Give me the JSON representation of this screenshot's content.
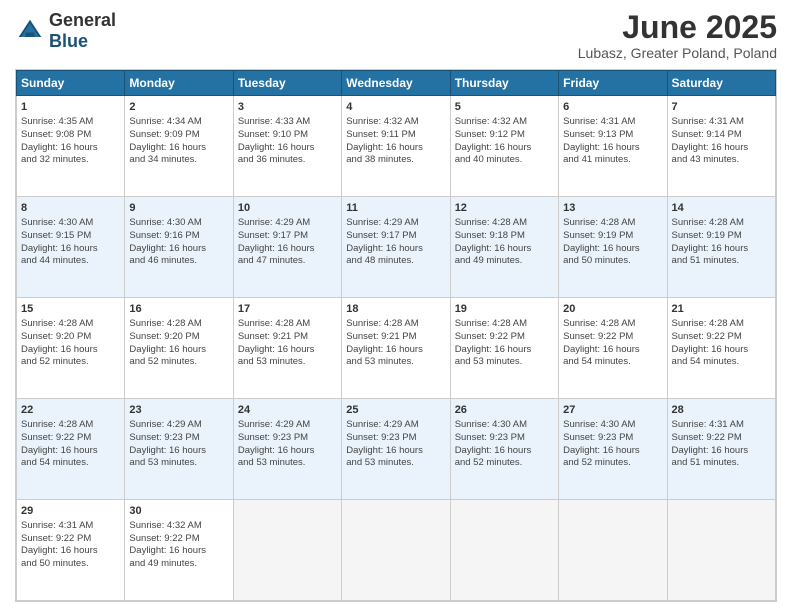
{
  "header": {
    "logo_general": "General",
    "logo_blue": "Blue",
    "month_title": "June 2025",
    "subtitle": "Lubasz, Greater Poland, Poland"
  },
  "calendar": {
    "days_of_week": [
      "Sunday",
      "Monday",
      "Tuesday",
      "Wednesday",
      "Thursday",
      "Friday",
      "Saturday"
    ],
    "weeks": [
      [
        {
          "day": "",
          "info": ""
        },
        {
          "day": "2",
          "info": "Sunrise: 4:34 AM\nSunset: 9:09 PM\nDaylight: 16 hours\nand 34 minutes."
        },
        {
          "day": "3",
          "info": "Sunrise: 4:33 AM\nSunset: 9:10 PM\nDaylight: 16 hours\nand 36 minutes."
        },
        {
          "day": "4",
          "info": "Sunrise: 4:32 AM\nSunset: 9:11 PM\nDaylight: 16 hours\nand 38 minutes."
        },
        {
          "day": "5",
          "info": "Sunrise: 4:32 AM\nSunset: 9:12 PM\nDaylight: 16 hours\nand 40 minutes."
        },
        {
          "day": "6",
          "info": "Sunrise: 4:31 AM\nSunset: 9:13 PM\nDaylight: 16 hours\nand 41 minutes."
        },
        {
          "day": "7",
          "info": "Sunrise: 4:31 AM\nSunset: 9:14 PM\nDaylight: 16 hours\nand 43 minutes."
        }
      ],
      [
        {
          "day": "8",
          "info": "Sunrise: 4:30 AM\nSunset: 9:15 PM\nDaylight: 16 hours\nand 44 minutes."
        },
        {
          "day": "9",
          "info": "Sunrise: 4:30 AM\nSunset: 9:16 PM\nDaylight: 16 hours\nand 46 minutes."
        },
        {
          "day": "10",
          "info": "Sunrise: 4:29 AM\nSunset: 9:17 PM\nDaylight: 16 hours\nand 47 minutes."
        },
        {
          "day": "11",
          "info": "Sunrise: 4:29 AM\nSunset: 9:17 PM\nDaylight: 16 hours\nand 48 minutes."
        },
        {
          "day": "12",
          "info": "Sunrise: 4:28 AM\nSunset: 9:18 PM\nDaylight: 16 hours\nand 49 minutes."
        },
        {
          "day": "13",
          "info": "Sunrise: 4:28 AM\nSunset: 9:19 PM\nDaylight: 16 hours\nand 50 minutes."
        },
        {
          "day": "14",
          "info": "Sunrise: 4:28 AM\nSunset: 9:19 PM\nDaylight: 16 hours\nand 51 minutes."
        }
      ],
      [
        {
          "day": "15",
          "info": "Sunrise: 4:28 AM\nSunset: 9:20 PM\nDaylight: 16 hours\nand 52 minutes."
        },
        {
          "day": "16",
          "info": "Sunrise: 4:28 AM\nSunset: 9:20 PM\nDaylight: 16 hours\nand 52 minutes."
        },
        {
          "day": "17",
          "info": "Sunrise: 4:28 AM\nSunset: 9:21 PM\nDaylight: 16 hours\nand 53 minutes."
        },
        {
          "day": "18",
          "info": "Sunrise: 4:28 AM\nSunset: 9:21 PM\nDaylight: 16 hours\nand 53 minutes."
        },
        {
          "day": "19",
          "info": "Sunrise: 4:28 AM\nSunset: 9:22 PM\nDaylight: 16 hours\nand 53 minutes."
        },
        {
          "day": "20",
          "info": "Sunrise: 4:28 AM\nSunset: 9:22 PM\nDaylight: 16 hours\nand 54 minutes."
        },
        {
          "day": "21",
          "info": "Sunrise: 4:28 AM\nSunset: 9:22 PM\nDaylight: 16 hours\nand 54 minutes."
        }
      ],
      [
        {
          "day": "22",
          "info": "Sunrise: 4:28 AM\nSunset: 9:22 PM\nDaylight: 16 hours\nand 54 minutes."
        },
        {
          "day": "23",
          "info": "Sunrise: 4:29 AM\nSunset: 9:23 PM\nDaylight: 16 hours\nand 53 minutes."
        },
        {
          "day": "24",
          "info": "Sunrise: 4:29 AM\nSunset: 9:23 PM\nDaylight: 16 hours\nand 53 minutes."
        },
        {
          "day": "25",
          "info": "Sunrise: 4:29 AM\nSunset: 9:23 PM\nDaylight: 16 hours\nand 53 minutes."
        },
        {
          "day": "26",
          "info": "Sunrise: 4:30 AM\nSunset: 9:23 PM\nDaylight: 16 hours\nand 52 minutes."
        },
        {
          "day": "27",
          "info": "Sunrise: 4:30 AM\nSunset: 9:23 PM\nDaylight: 16 hours\nand 52 minutes."
        },
        {
          "day": "28",
          "info": "Sunrise: 4:31 AM\nSunset: 9:22 PM\nDaylight: 16 hours\nand 51 minutes."
        }
      ],
      [
        {
          "day": "29",
          "info": "Sunrise: 4:31 AM\nSunset: 9:22 PM\nDaylight: 16 hours\nand 50 minutes."
        },
        {
          "day": "30",
          "info": "Sunrise: 4:32 AM\nSunset: 9:22 PM\nDaylight: 16 hours\nand 49 minutes."
        },
        {
          "day": "",
          "info": ""
        },
        {
          "day": "",
          "info": ""
        },
        {
          "day": "",
          "info": ""
        },
        {
          "day": "",
          "info": ""
        },
        {
          "day": "",
          "info": ""
        }
      ]
    ],
    "week0_day1": {
      "day": "1",
      "info": "Sunrise: 4:35 AM\nSunset: 9:08 PM\nDaylight: 16 hours\nand 32 minutes."
    }
  }
}
